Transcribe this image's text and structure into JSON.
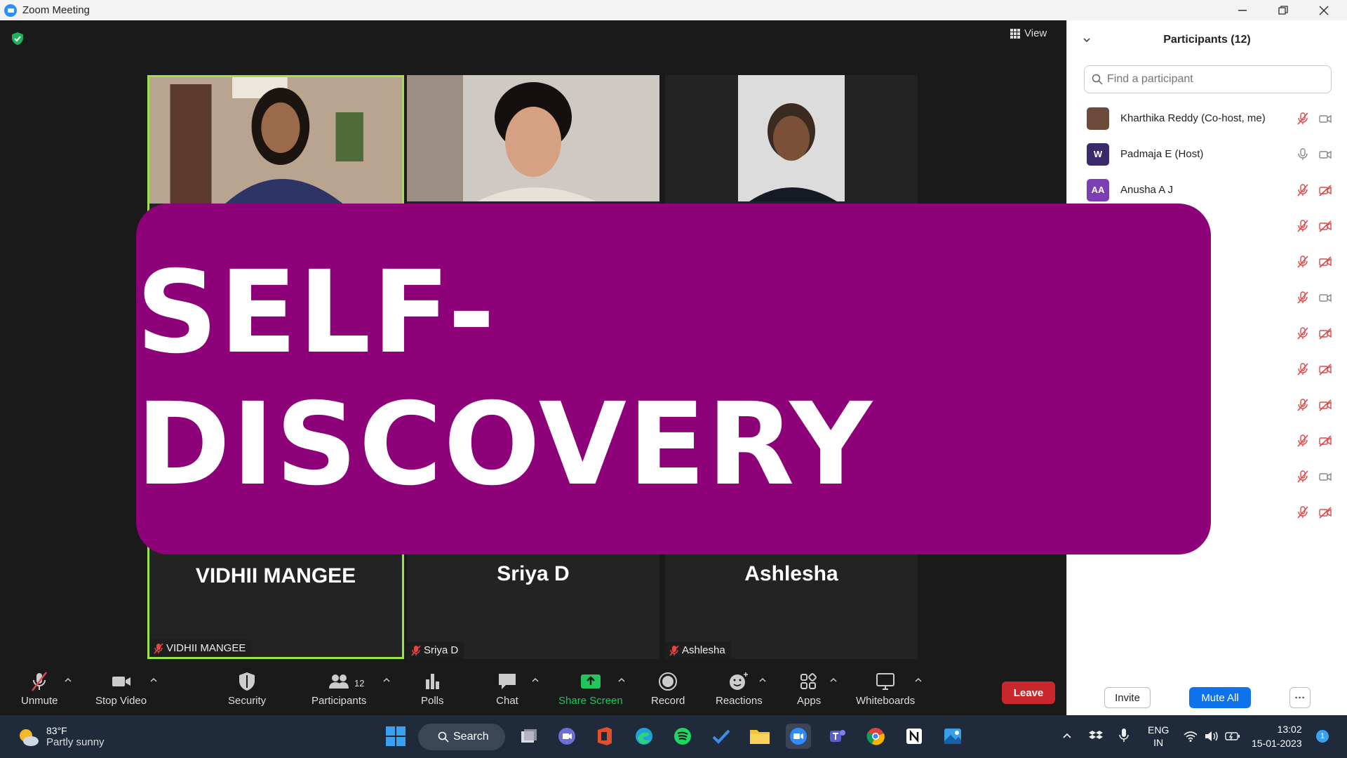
{
  "window": {
    "title": "Zoom Meeting"
  },
  "meeting": {
    "view_label": "View",
    "banner_text": "SELF-DISCOVERY"
  },
  "tiles": [
    {
      "big_name": "VIDHII MANGEE",
      "chip": "VIDHII MANGEE",
      "active": true
    },
    {
      "big_name": "Sriya D",
      "chip": "Sriya D",
      "active": false
    },
    {
      "big_name": "Ashlesha",
      "chip": "Ashlesha",
      "active": false
    }
  ],
  "participants_panel": {
    "title": "Participants (12)",
    "search_placeholder": "Find a participant",
    "participants": [
      {
        "name": "Kharthika Reddy (Co-host, me)",
        "initials": "",
        "avatar_color": "#6b4a3a",
        "mic": "muted",
        "video": "on"
      },
      {
        "name": "Padmaja E (Host)",
        "initials": "W",
        "avatar_color": "#3b2a6a",
        "mic": "on",
        "video": "on"
      },
      {
        "name": "Anusha A J",
        "initials": "AA",
        "avatar_color": "#7b3fb3",
        "mic": "muted",
        "video": "off"
      },
      {
        "name": "",
        "initials": "",
        "avatar_color": "",
        "mic": "muted",
        "video": "off"
      },
      {
        "name": "",
        "initials": "",
        "avatar_color": "",
        "mic": "muted",
        "video": "off"
      },
      {
        "name": "",
        "initials": "",
        "avatar_color": "",
        "mic": "muted",
        "video": "on"
      },
      {
        "name": "",
        "initials": "",
        "avatar_color": "",
        "mic": "muted",
        "video": "off"
      },
      {
        "name": "",
        "initials": "",
        "avatar_color": "",
        "mic": "muted",
        "video": "off"
      },
      {
        "name": "",
        "initials": "",
        "avatar_color": "",
        "mic": "muted",
        "video": "off"
      },
      {
        "name": "",
        "initials": "",
        "avatar_color": "",
        "mic": "muted",
        "video": "off"
      },
      {
        "name": "",
        "initials": "",
        "avatar_color": "",
        "mic": "muted",
        "video": "on"
      },
      {
        "name": "",
        "initials": "",
        "avatar_color": "",
        "mic": "muted",
        "video": "off"
      }
    ],
    "invite_label": "Invite",
    "mute_all_label": "Mute All",
    "more_label": "···"
  },
  "toolbar": {
    "unmute": "Unmute",
    "stop_video": "Stop Video",
    "security": "Security",
    "participants": "Participants",
    "participants_count": "12",
    "polls": "Polls",
    "chat": "Chat",
    "share_screen": "Share Screen",
    "record": "Record",
    "reactions": "Reactions",
    "apps": "Apps",
    "whiteboards": "Whiteboards",
    "leave": "Leave"
  },
  "taskbar": {
    "weather_temp": "83°F",
    "weather_desc": "Partly sunny",
    "search_label": "Search",
    "lang_1": "ENG",
    "lang_2": "IN",
    "time": "13:02",
    "date": "15-01-2023",
    "notification_count": "1"
  },
  "colors": {
    "banner": "#8d0179",
    "active_speaker": "#9be34a",
    "share_green": "#22c55e",
    "leave_red": "#c8282d",
    "accent_blue": "#0e72ed"
  }
}
